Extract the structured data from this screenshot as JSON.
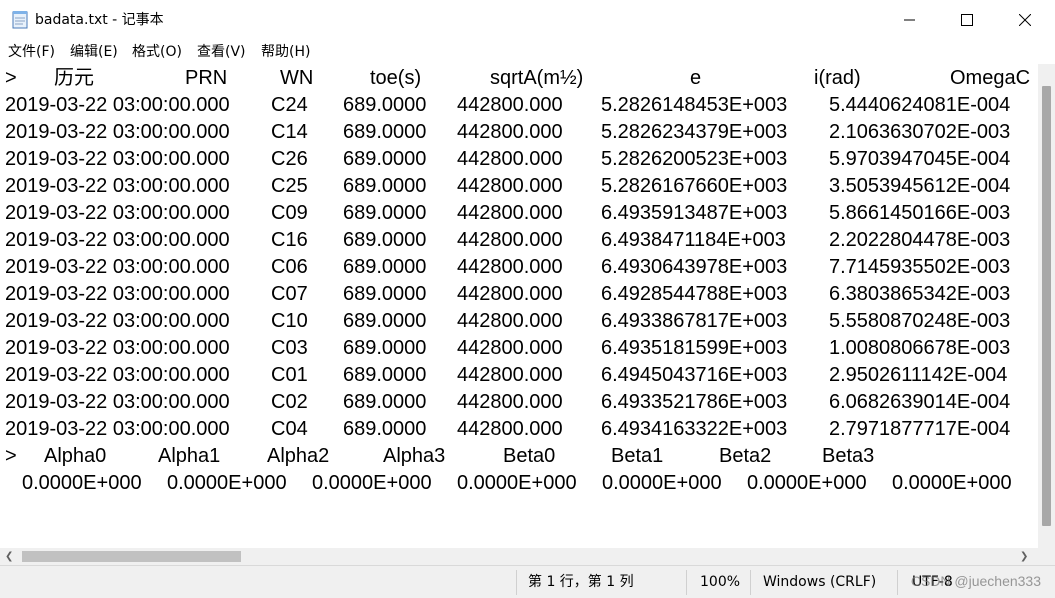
{
  "window": {
    "title": "badata.txt - 记事本",
    "icon": "notepad-icon",
    "controls": [
      "minimize-icon",
      "maximize-icon",
      "close-icon"
    ]
  },
  "menu": [
    "文件(F)",
    "编辑(E)",
    "格式(O)",
    "查看(V)",
    "帮助(H)"
  ],
  "document": {
    "header1": [
      ">",
      "历元",
      "PRN",
      "WN",
      "toe(s)",
      "sqrtA(m½)",
      "e",
      "i(rad)",
      "OmegaC"
    ],
    "rows": [
      [
        "2019-03-22 03:00:00.000",
        "C24",
        "689.0000",
        "442800.000",
        "5.2826148453E+003",
        "5.4440624081E-004"
      ],
      [
        "2019-03-22 03:00:00.000",
        "C14",
        "689.0000",
        "442800.000",
        "5.2826234379E+003",
        "2.1063630702E-003"
      ],
      [
        "2019-03-22 03:00:00.000",
        "C26",
        "689.0000",
        "442800.000",
        "5.2826200523E+003",
        "5.9703947045E-004"
      ],
      [
        "2019-03-22 03:00:00.000",
        "C25",
        "689.0000",
        "442800.000",
        "5.2826167660E+003",
        "3.5053945612E-004"
      ],
      [
        "2019-03-22 03:00:00.000",
        "C09",
        "689.0000",
        "442800.000",
        "6.4935913487E+003",
        "5.8661450166E-003"
      ],
      [
        "2019-03-22 03:00:00.000",
        "C16",
        "689.0000",
        "442800.000",
        "6.4938471184E+003",
        "2.2022804478E-003"
      ],
      [
        "2019-03-22 03:00:00.000",
        "C06",
        "689.0000",
        "442800.000",
        "6.4930643978E+003",
        "7.7145935502E-003"
      ],
      [
        "2019-03-22 03:00:00.000",
        "C07",
        "689.0000",
        "442800.000",
        "6.4928544788E+003",
        "6.3803865342E-003"
      ],
      [
        "2019-03-22 03:00:00.000",
        "C10",
        "689.0000",
        "442800.000",
        "6.4933867817E+003",
        "5.5580870248E-003"
      ],
      [
        "2019-03-22 03:00:00.000",
        "C03",
        "689.0000",
        "442800.000",
        "6.4935181599E+003",
        "1.0080806678E-003"
      ],
      [
        "2019-03-22 03:00:00.000",
        "C01",
        "689.0000",
        "442800.000",
        "6.4945043716E+003",
        "2.9502611142E-004"
      ],
      [
        "2019-03-22 03:00:00.000",
        "C02",
        "689.0000",
        "442800.000",
        "6.4933521786E+003",
        "6.0682639014E-004"
      ],
      [
        "2019-03-22 03:00:00.000",
        "C04",
        "689.0000",
        "442800.000",
        "6.4934163322E+003",
        "2.7971877717E-004"
      ]
    ],
    "header2": [
      ">",
      "Alpha0",
      "Alpha1",
      "Alpha2",
      "Alpha3",
      "Beta0",
      "Beta1",
      "Beta2",
      "Beta3"
    ],
    "iono_values": [
      "0.0000E+000",
      "0.0000E+000",
      "0.0000E+000",
      "0.0000E+000",
      "0.0000E+000",
      "0.0000E+000",
      "0.0000E+000"
    ]
  },
  "scroll_icons": [
    "scroll-left-icon",
    "scroll-right-icon"
  ],
  "status": {
    "position": "第 1 行，第 1 列",
    "zoom": "100%",
    "line_ending": "Windows (CRLF)",
    "encoding": "UTF-8"
  },
  "watermark": "CSDN @juechen333"
}
